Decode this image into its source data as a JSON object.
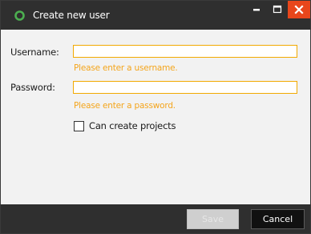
{
  "window": {
    "title": "Create new user",
    "app_icon": "app-ring-icon",
    "controls": {
      "minimize": "minimize-icon",
      "maximize": "maximize-icon",
      "close": "close-icon"
    }
  },
  "form": {
    "username": {
      "label": "Username:",
      "value": "",
      "error": "Please enter a username."
    },
    "password": {
      "label": "Password:",
      "value": "",
      "error": "Please enter a password."
    },
    "can_create_projects": {
      "label": "Can create projects",
      "checked": false
    }
  },
  "footer": {
    "save_label": "Save",
    "save_enabled": false,
    "cancel_label": "Cancel"
  },
  "colors": {
    "titlebar": "#2f2f2f",
    "close_button": "#e8461b",
    "field_border": "#f2a900",
    "error_text": "#f4a51c",
    "app_icon": "#4caf50"
  }
}
